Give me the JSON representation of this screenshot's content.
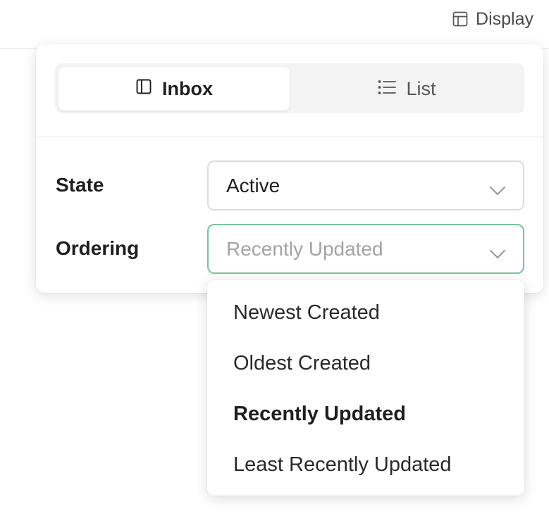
{
  "topbar": {
    "display_label": "Display",
    "display_icon": "table-icon"
  },
  "view_toggle": {
    "options": [
      {
        "label": "Inbox",
        "icon": "sidebar-panel-icon",
        "active": true
      },
      {
        "label": "List",
        "icon": "list-icon",
        "active": false
      }
    ]
  },
  "filters": {
    "state": {
      "label": "State",
      "value": "Active"
    },
    "ordering": {
      "label": "Ordering",
      "value": "Recently Updated"
    }
  },
  "ordering_menu": {
    "items": [
      {
        "label": "Newest Created",
        "selected": false
      },
      {
        "label": "Oldest Created",
        "selected": false
      },
      {
        "label": "Recently Updated",
        "selected": true
      },
      {
        "label": "Least Recently Updated",
        "selected": false
      }
    ]
  },
  "colors": {
    "focus_border": "#7cc49b",
    "segment_bg": "#f3f3f3",
    "text": "#1f1f1f"
  }
}
